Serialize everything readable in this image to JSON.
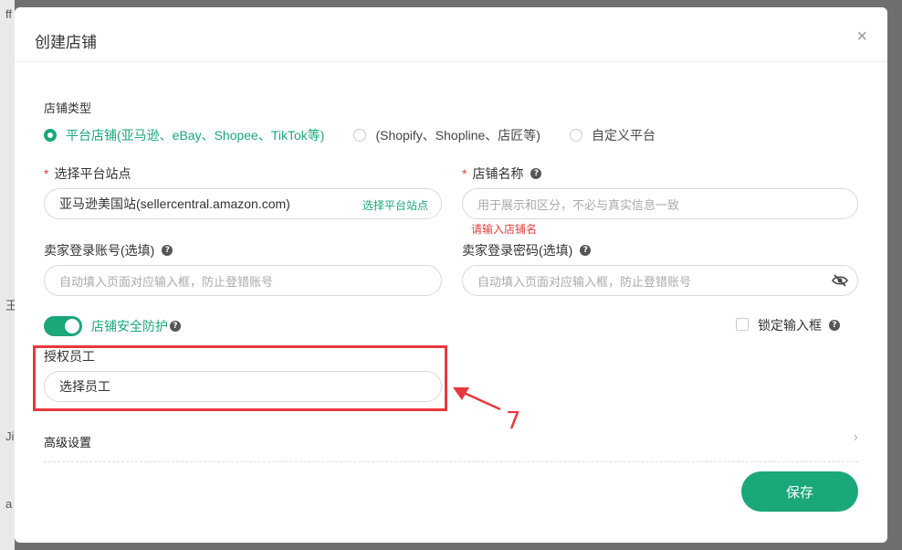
{
  "dialog": {
    "title": "创建店铺",
    "close_glyph": "×"
  },
  "store_type": {
    "label": "店铺类型",
    "options": [
      {
        "label": "平台店铺(亚马逊、eBay、Shopee、TikTok等)",
        "checked": true
      },
      {
        "label": "(Shopify、Shopline、店匠等)",
        "checked": false
      },
      {
        "label": "自定义平台",
        "checked": false
      }
    ]
  },
  "platform_site": {
    "required_mark": "*",
    "label": "选择平台站点",
    "value": "亚马逊美国站(sellercentral.amazon.com)",
    "link": "选择平台站点"
  },
  "store_name": {
    "required_mark": "*",
    "label": "店铺名称",
    "placeholder": "用于展示和区分，不必与真实信息一致",
    "error": "请输入店铺名"
  },
  "seller_account": {
    "label": "卖家登录账号(选填)",
    "placeholder": "自动填入页面对应输入框，防止登错账号"
  },
  "seller_password": {
    "label": "卖家登录密码(选填)",
    "placeholder": "自动填入页面对应输入框，防止登错账号"
  },
  "security_toggle": {
    "label": "店铺安全防护",
    "on": true
  },
  "lock_input": {
    "label": "锁定输入框",
    "checked": false
  },
  "staff": {
    "label": "授权员工",
    "value": "选择员工"
  },
  "annotation": {
    "number": "7"
  },
  "advanced": {
    "label": "高级设置",
    "chevron": "›"
  },
  "save_label": "保存",
  "background": {
    "left_chars": [
      "ff",
      "王",
      "Ji",
      "a"
    ]
  },
  "colors": {
    "accent": "#1aa779",
    "error": "#e23c3c",
    "annotation": "#e8383d"
  },
  "icons": [
    "help-icon",
    "eye-off-icon",
    "close-icon",
    "chevron-right-icon"
  ]
}
